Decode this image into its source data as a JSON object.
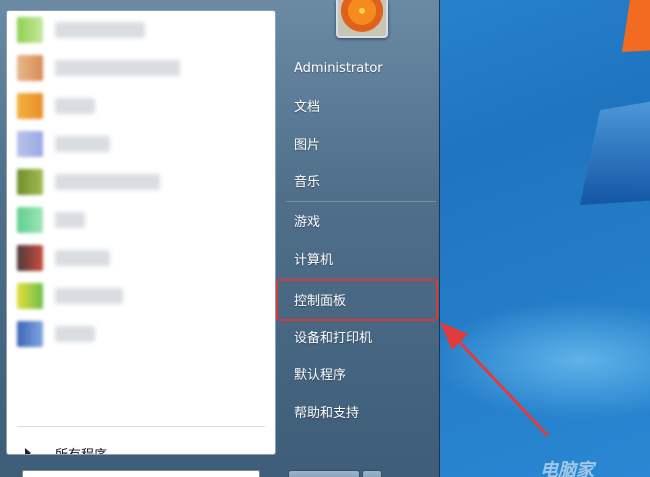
{
  "colors": {
    "desktop_blue": "#2a82cc",
    "menu_frame": "#4f6f8b",
    "left_pane": "#ffffff",
    "highlight_red": "#d43a3a",
    "arrow_red": "#e23b3b"
  },
  "start_menu": {
    "user": {
      "picture_icon": "flower-avatar-icon",
      "name": "Administrator"
    },
    "right_items": [
      {
        "label": "文档"
      },
      {
        "label": "图片"
      },
      {
        "label": "音乐"
      },
      {
        "label": "游戏"
      },
      {
        "label": "计算机"
      },
      {
        "label": "控制面板"
      },
      {
        "label": "设备和打印机"
      },
      {
        "label": "默认程序"
      },
      {
        "label": "帮助和支持"
      }
    ],
    "left_pane": {
      "all_programs_label": "所有程序"
    }
  }
}
